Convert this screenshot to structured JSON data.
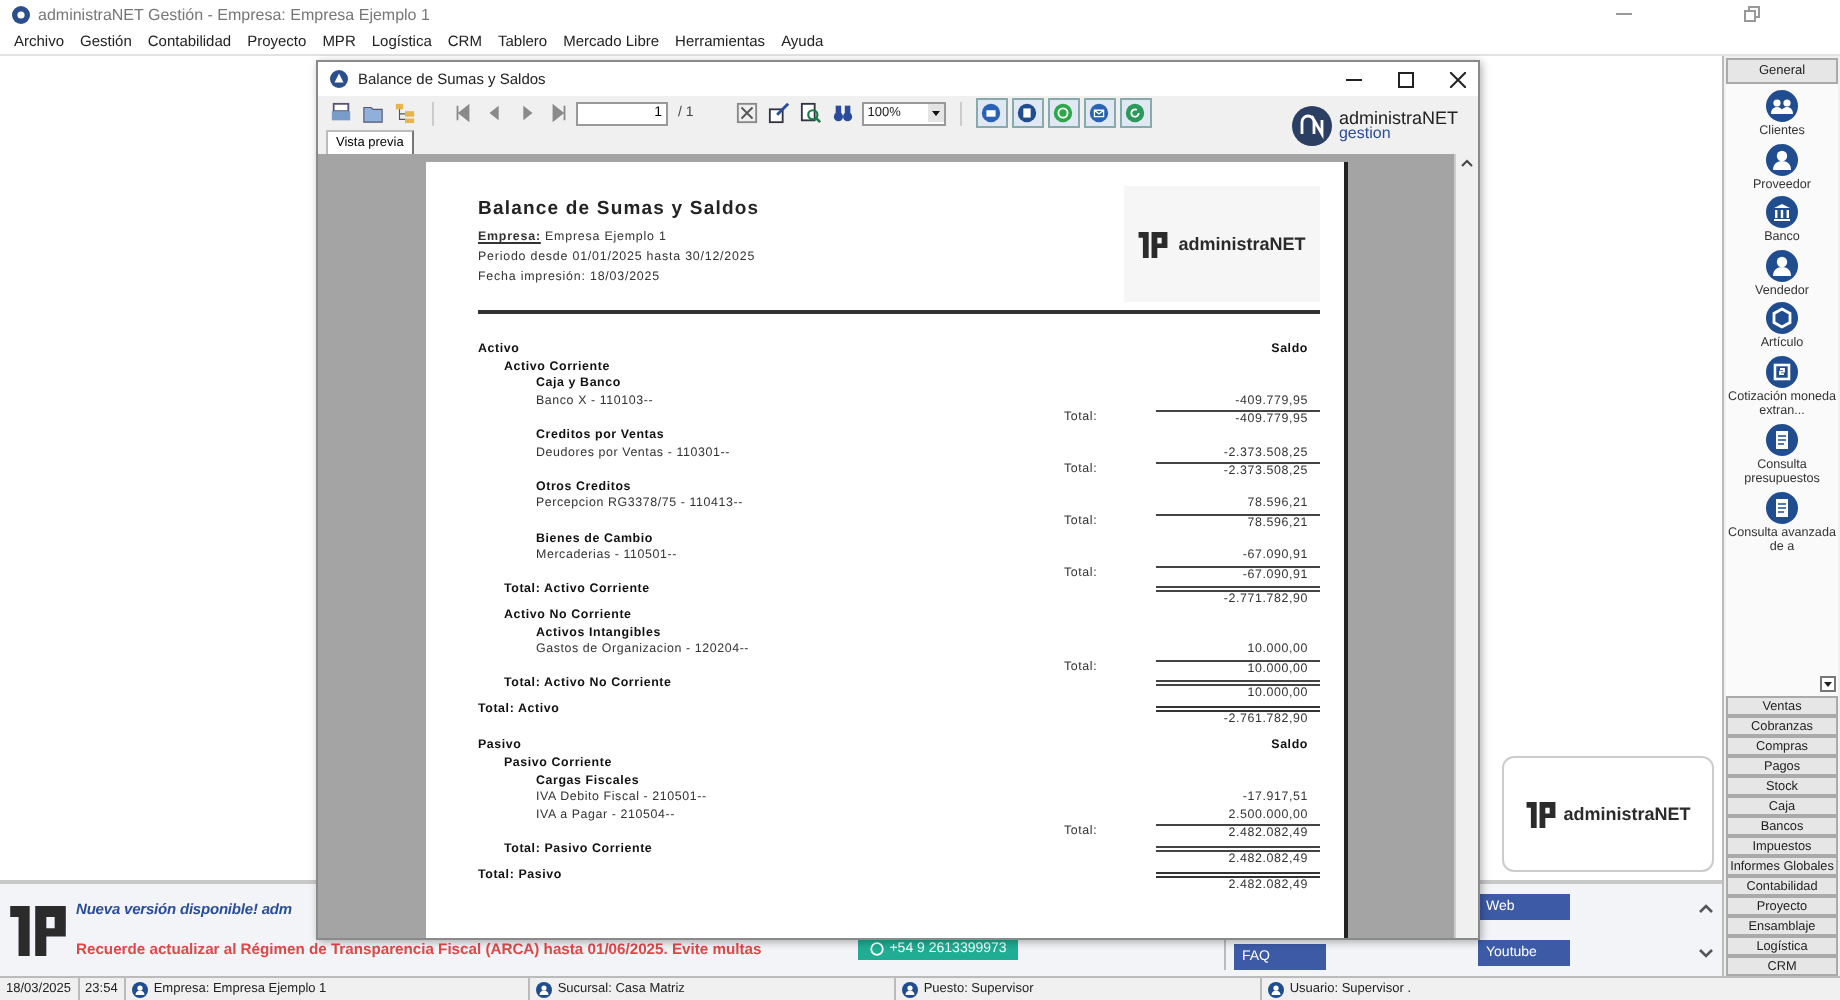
{
  "window": {
    "title": "administraNET Gestión - Empresa: Empresa Ejemplo 1"
  },
  "menu": [
    "Archivo",
    "Gestión",
    "Contabilidad",
    "Proyecto",
    "MPR",
    "Logística",
    "CRM",
    "Tablero",
    "Mercado Libre",
    "Herramientas",
    "Ayuda"
  ],
  "dialog": {
    "title": "Balance de Sumas y Saldos",
    "page_field": "1",
    "page_count": "/ 1",
    "zoom": "100%",
    "logo_name": "administraNET",
    "logo_sub": "gestion",
    "tabs": [
      {
        "label": "Vista previa",
        "selected": true
      }
    ]
  },
  "report": {
    "title": "Balance de Sumas y Saldos",
    "company_line": "**Empresa:** Empresa Ejemplo 1",
    "period": "Periodo desde  01/01/2025 hasta 30/12/2025",
    "printed": "Fecha impresión: 18/03/2025",
    "logo_text": "administraNET",
    "sections": [
      {
        "name": "Activo",
        "column": "Saldo",
        "groups": [
          {
            "name": "Activo Corriente",
            "subgroups": [
              {
                "name": "Caja y Banco",
                "accounts": [
                  {
                    "name": "Banco X - 110103--",
                    "amount": "-409.779,95"
                  }
                ],
                "total_label": "Total:",
                "total": "-409.779,95"
              },
              {
                "name": "Creditos por Ventas",
                "accounts": [
                  {
                    "name": "Deudores por Ventas - 110301--",
                    "amount": "-2.373.508,25"
                  }
                ],
                "total_label": "Total:",
                "total": "-2.373.508,25"
              },
              {
                "name": "Otros Creditos",
                "accounts": [
                  {
                    "name": "Percepcion RG3378/75 - 110413--",
                    "amount": "78.596,21"
                  }
                ],
                "total_label": "Total:",
                "total": "78.596,21"
              },
              {
                "name": "Bienes de Cambio",
                "accounts": [
                  {
                    "name": "Mercaderias - 110501--",
                    "amount": "-67.090,91"
                  }
                ],
                "total_label": "Total:",
                "total": "-67.090,91"
              }
            ],
            "total_label": "Total: Activo Corriente",
            "total": "-2.771.782,90"
          },
          {
            "name": "Activo No Corriente",
            "subgroups": [
              {
                "name": "Activos Intangibles",
                "accounts": [
                  {
                    "name": "Gastos de Organizacion - 120204--",
                    "amount": "10.000,00"
                  }
                ],
                "total_label": "Total:",
                "total": "10.000,00"
              }
            ],
            "total_label": "Total: Activo No Corriente",
            "total": "10.000,00"
          }
        ],
        "total_label": "Total: Activo",
        "total": "-2.761.782,90"
      },
      {
        "name": "Pasivo",
        "column": "Saldo",
        "groups": [
          {
            "name": "Pasivo Corriente",
            "subgroups": [
              {
                "name": "Cargas Fiscales",
                "accounts": [
                  {
                    "name": "IVA Debito Fiscal - 210501--",
                    "amount": "-17.917,51"
                  },
                  {
                    "name": "IVA a Pagar - 210504--",
                    "amount": "2.500.000,00"
                  }
                ],
                "total_label": "Total:",
                "total": "2.482.082,49"
              }
            ],
            "total_label": "Total: Pasivo Corriente",
            "total": "2.482.082,49"
          }
        ],
        "total_label": "Total: Pasivo",
        "total": "2.482.082,49"
      }
    ]
  },
  "logo_card": {
    "text": "administraNET"
  },
  "banner": {
    "headline": "Nueva versión disponible! adm",
    "notice": "Recuerde actualizar al Régimen de Transparencia Fiscal (ARCA) hasta 01/06/2025. Evite multas",
    "phone": "+54 9 2613399973",
    "links": [
      {
        "label": "FAQ"
      },
      {
        "label": "Web"
      },
      {
        "label": "Youtube"
      }
    ]
  },
  "sidebar": {
    "header": "General",
    "items": [
      "Clientes",
      "Proveedor",
      "Banco",
      "Vendedor",
      "Artículo",
      "Cotización moneda extran...",
      "Consulta presupuestos",
      "Consulta avanzada de a"
    ],
    "sections": [
      "Ventas",
      "Cobranzas",
      "Compras",
      "Pagos",
      "Stock",
      "Caja",
      "Bancos",
      "Impuestos",
      "Informes Globales",
      "Contabilidad",
      "Proyecto",
      "Ensamblaje",
      "Logística",
      "CRM"
    ]
  },
  "status_bar": {
    "date": "18/03/2025",
    "time": "23:54",
    "company": "Empresa: Empresa Ejemplo 1",
    "branch": "Sucursal: Casa Matriz",
    "post": "Puesto: Supervisor",
    "user": "Usuario: Supervisor ."
  }
}
